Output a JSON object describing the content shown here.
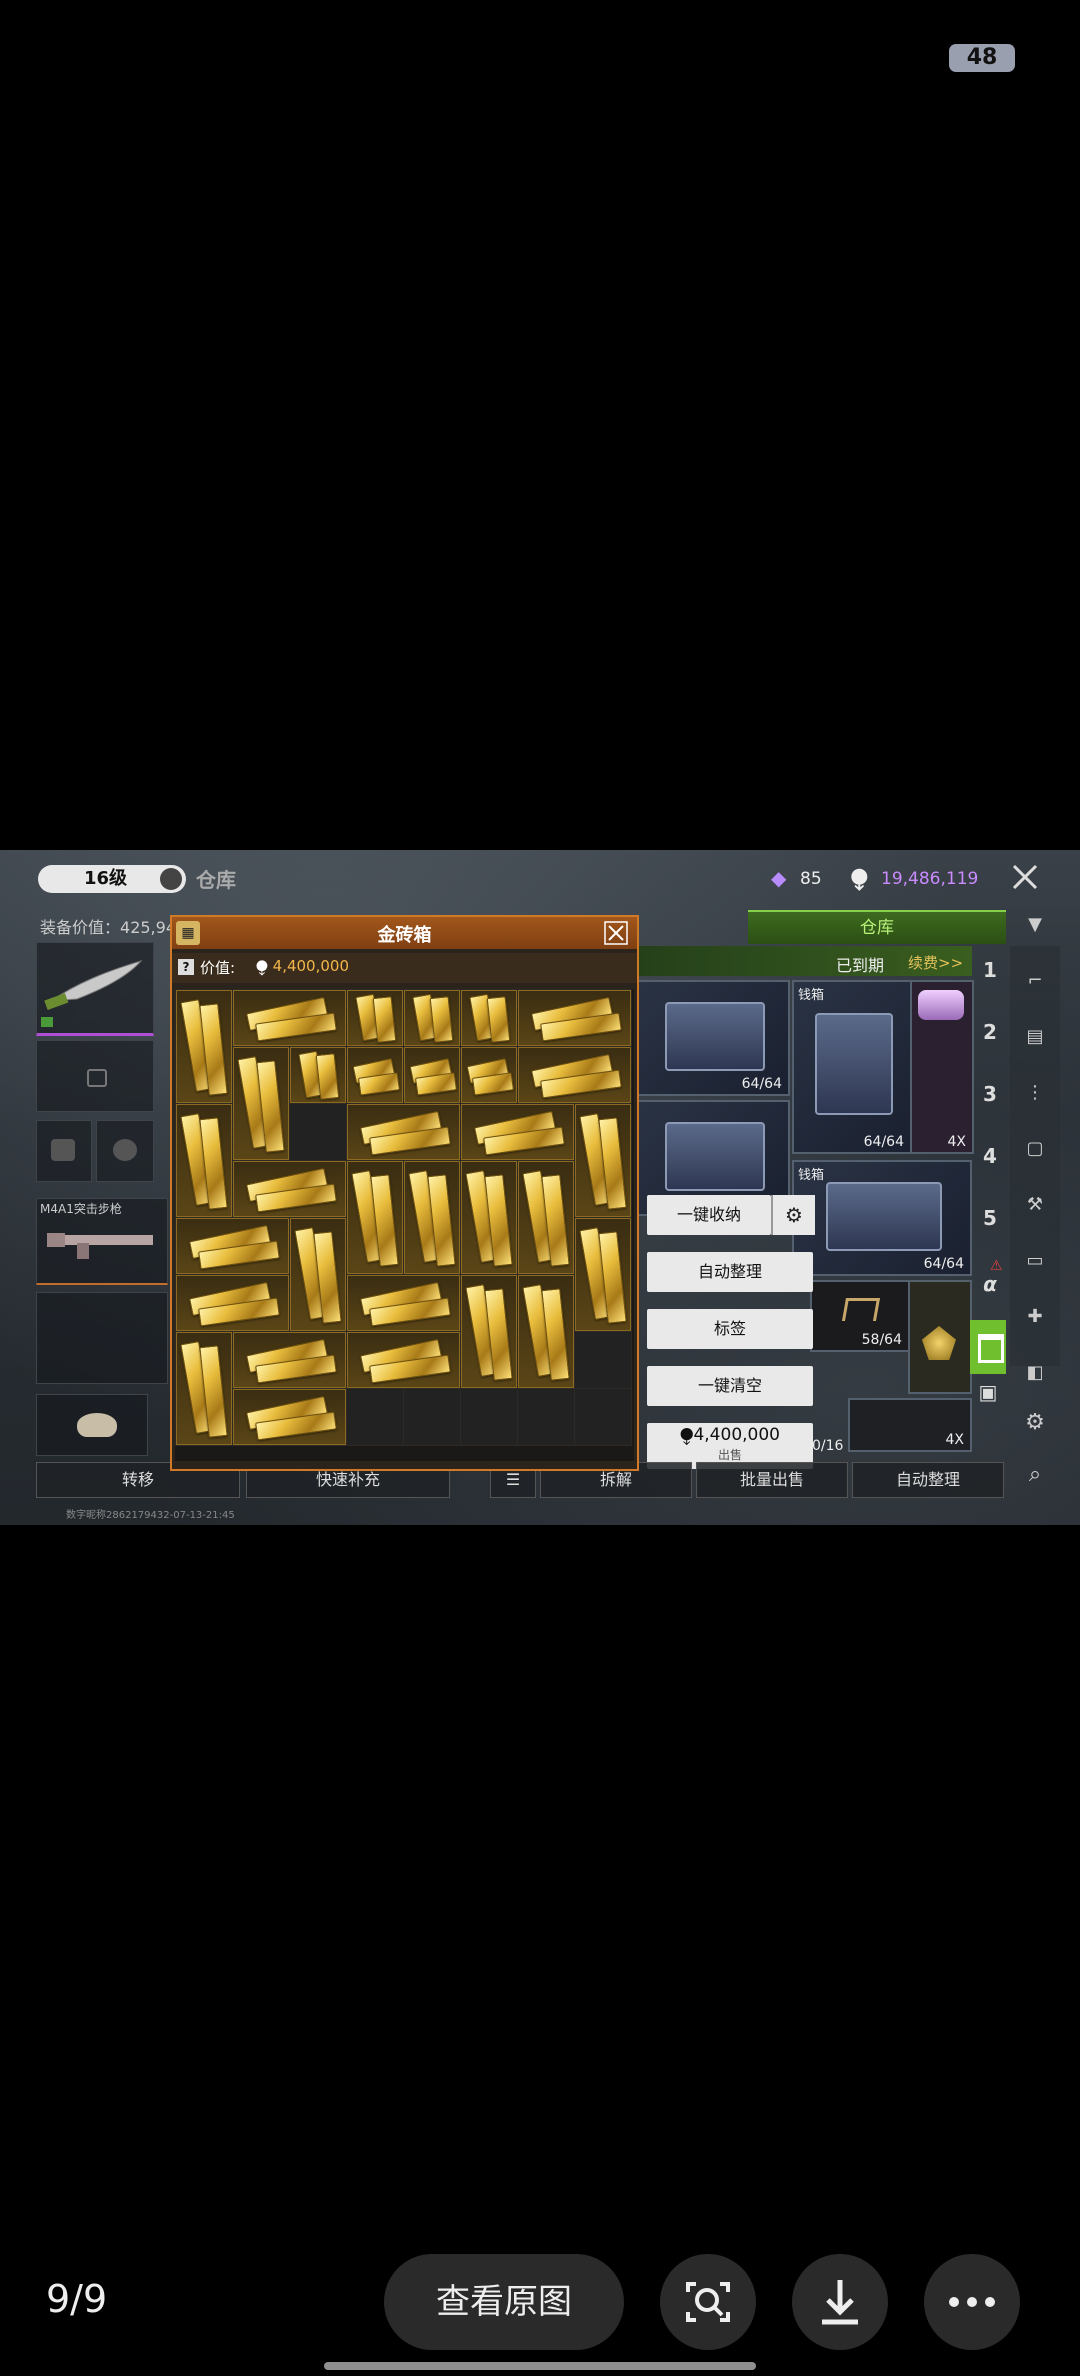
{
  "status_bar": {
    "battery": "48"
  },
  "game": {
    "level": "16级",
    "page_title": "仓库",
    "diamonds": "85",
    "currency_symbol": "⧭",
    "coins": "19,486,119",
    "equip_value_label": "装备价值：",
    "equip_value": "425,94",
    "weapon_label": "M4A1突击步枪",
    "tab_warehouse": "仓库",
    "expired_label": "已到期",
    "renew_label": "续费>>",
    "crate_counts": [
      "64/64",
      "64/64",
      "64/64",
      "58/64",
      "0/16"
    ],
    "crate_names": [
      "钱箱",
      "钱箱"
    ],
    "crate_multiplier": "4X",
    "side_numbers": [
      "1",
      "2",
      "3",
      "4",
      "5",
      "α"
    ],
    "popup": {
      "title": "金砖箱",
      "value_label": "价值:",
      "value_symbol": "⧭",
      "value_amount": "4,400,000"
    },
    "menu": {
      "stow_all": "一键收纳",
      "auto_sort": "自动整理",
      "tags": "标签",
      "clear_all": "一键清空",
      "sell_price": "⧭4,400,000",
      "sell_label": "出售"
    },
    "bottom_buttons": {
      "transfer": "转移",
      "quick_refill": "快速补充",
      "dismantle": "拆解",
      "batch_sell": "批量出售",
      "auto_sort": "自动整理"
    },
    "footer_meta": "数字昵称2862179432-07-13-21:45"
  },
  "viewer": {
    "counter": "9/9",
    "view_original": "查看原图"
  },
  "colors": {
    "accent_orange": "#d07a27",
    "tab_green": "#86d14a",
    "coin_purple": "#c98bff",
    "gold": "#e9be3e"
  }
}
